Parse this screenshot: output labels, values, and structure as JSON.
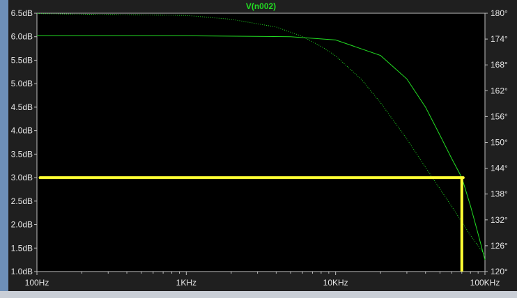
{
  "chart_data": {
    "type": "line",
    "title": "V(n002)",
    "x_scale": "log",
    "x_range_hz": [
      100,
      100000
    ],
    "x_ticks": [
      {
        "value": 100,
        "label": "100Hz"
      },
      {
        "value": 1000,
        "label": "1KHz"
      },
      {
        "value": 10000,
        "label": "10KHz"
      },
      {
        "value": 100000,
        "label": "100KHz"
      }
    ],
    "y_left": {
      "unit": "dB",
      "range": [
        1.0,
        6.5
      ],
      "ticks": [
        "1.0dB",
        "1.5dB",
        "2.0dB",
        "2.5dB",
        "3.0dB",
        "3.5dB",
        "4.0dB",
        "4.5dB",
        "5.0dB",
        "5.5dB",
        "6.0dB",
        "6.5dB"
      ],
      "tick_values": [
        1.0,
        1.5,
        2.0,
        2.5,
        3.0,
        3.5,
        4.0,
        4.5,
        5.0,
        5.5,
        6.0,
        6.5
      ]
    },
    "y_right": {
      "unit": "deg",
      "range": [
        120,
        180
      ],
      "ticks": [
        "120°",
        "126°",
        "132°",
        "138°",
        "144°",
        "150°",
        "156°",
        "162°",
        "168°",
        "174°",
        "180°"
      ],
      "tick_values": [
        120,
        126,
        132,
        138,
        144,
        150,
        156,
        162,
        168,
        174,
        180
      ]
    },
    "series": [
      {
        "axis": "left",
        "style": "solid",
        "color": "#22dd22",
        "points": [
          [
            100,
            6.02
          ],
          [
            1000,
            6.02
          ],
          [
            5000,
            6.0
          ],
          [
            10000,
            5.93
          ],
          [
            20000,
            5.6
          ],
          [
            30000,
            5.1
          ],
          [
            40000,
            4.5
          ],
          [
            50000,
            3.9
          ],
          [
            60000,
            3.4
          ],
          [
            70000,
            3.0
          ],
          [
            80000,
            2.4
          ],
          [
            90000,
            1.8
          ],
          [
            100000,
            1.25
          ]
        ]
      },
      {
        "axis": "right",
        "style": "dotted",
        "color": "#22dd22",
        "points": [
          [
            100,
            179.9
          ],
          [
            1000,
            179.5
          ],
          [
            2000,
            178.6
          ],
          [
            4000,
            176.8
          ],
          [
            6000,
            174.6
          ],
          [
            8000,
            172.3
          ],
          [
            10000,
            170.1
          ],
          [
            15000,
            164.5
          ],
          [
            20000,
            159.2
          ],
          [
            30000,
            150.8
          ],
          [
            40000,
            144.2
          ],
          [
            50000,
            139.2
          ],
          [
            60000,
            135.1
          ],
          [
            70000,
            131.5
          ],
          [
            80000,
            128.4
          ],
          [
            100000,
            123.8
          ]
        ]
      }
    ],
    "annotations": [
      {
        "type": "hline",
        "y_db": 3.0,
        "x_from_hz": 105,
        "x_to_hz": 70000,
        "color": "#ffff33"
      },
      {
        "type": "vline",
        "x_hz": 70000,
        "y_from_db": 3.0,
        "y_to_db": 1.0,
        "color": "#ffff33"
      }
    ],
    "grid": false,
    "legend": "none",
    "background": "#000000",
    "axis_color": "#bfbfbf",
    "tick_label_color": "#e6e6e6",
    "title_color": "#22dd22"
  }
}
